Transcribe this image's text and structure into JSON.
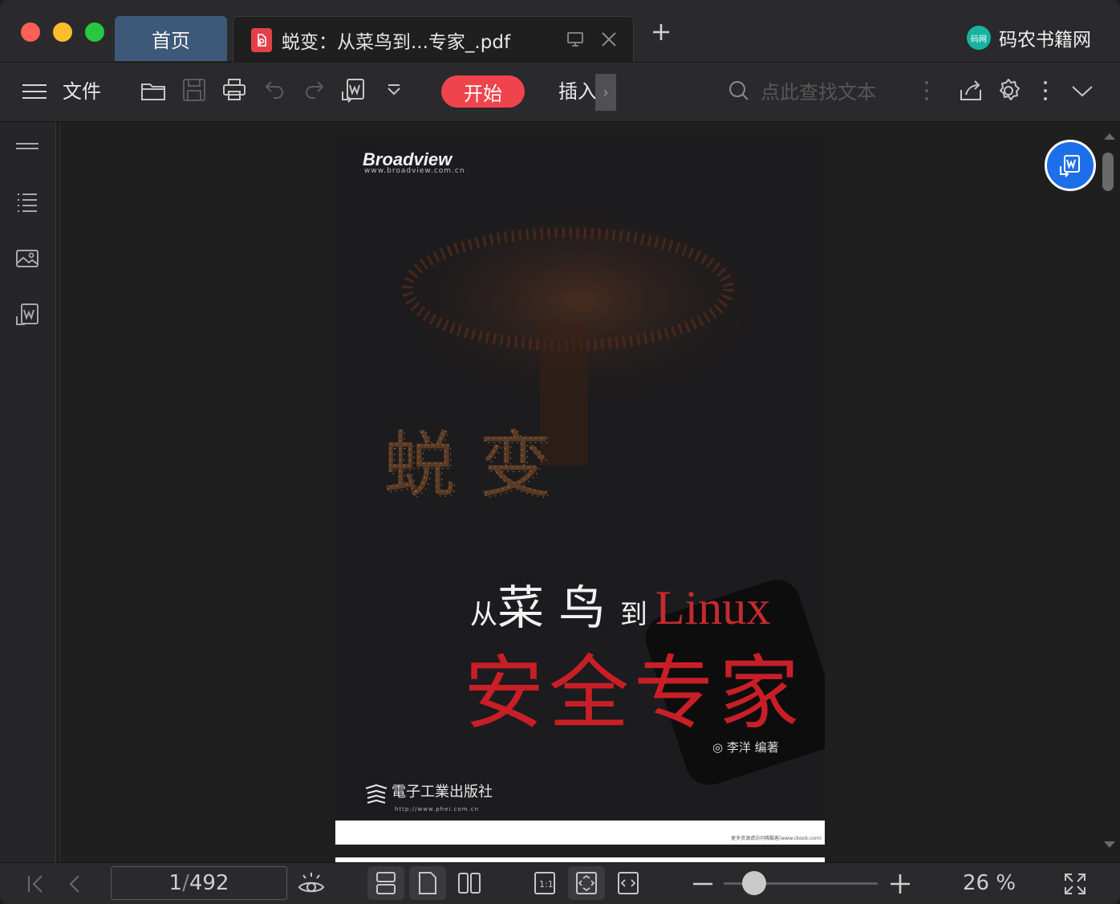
{
  "tabs": {
    "home": "首页",
    "document": "蜕变：从菜鸟到...专家_.pdf",
    "pdf_badge": "P"
  },
  "brand": {
    "logo_text": "码网",
    "name": "码农书籍网"
  },
  "toolbar": {
    "file_label": "文件",
    "start_label": "开始",
    "insert_label": "插入",
    "search_placeholder": "点此查找文本"
  },
  "cover": {
    "publisher_brand": "Broadview",
    "publisher_brand_url": "www.broadview.com.cn",
    "title_line1_a": "从",
    "title_line1_b": "菜 鸟",
    "title_line1_c": "到",
    "title_line1_linux": "Linux",
    "title_line2": "安全专家",
    "author": "◎  李洋  编著",
    "publisher": "電子工業出版社",
    "publisher_url": "http://www.phei.com.cn",
    "footer_note": "更多资源请访问稀酷客(www.ckook.com)"
  },
  "status": {
    "current_page": "1",
    "separator": "/",
    "total_pages": "492",
    "zoom_percent": "26 %",
    "zoom_level": 0.2
  },
  "colors": {
    "accent_red": "#f0444d",
    "tab_home_bg": "#3d5879",
    "fab_blue": "#1c6fe8",
    "brand_teal": "#18b3a0"
  },
  "icons": {
    "sidebar": [
      "thumbnail-toggle-icon",
      "outline-icon",
      "image-icon",
      "pdf-to-word-icon"
    ]
  }
}
